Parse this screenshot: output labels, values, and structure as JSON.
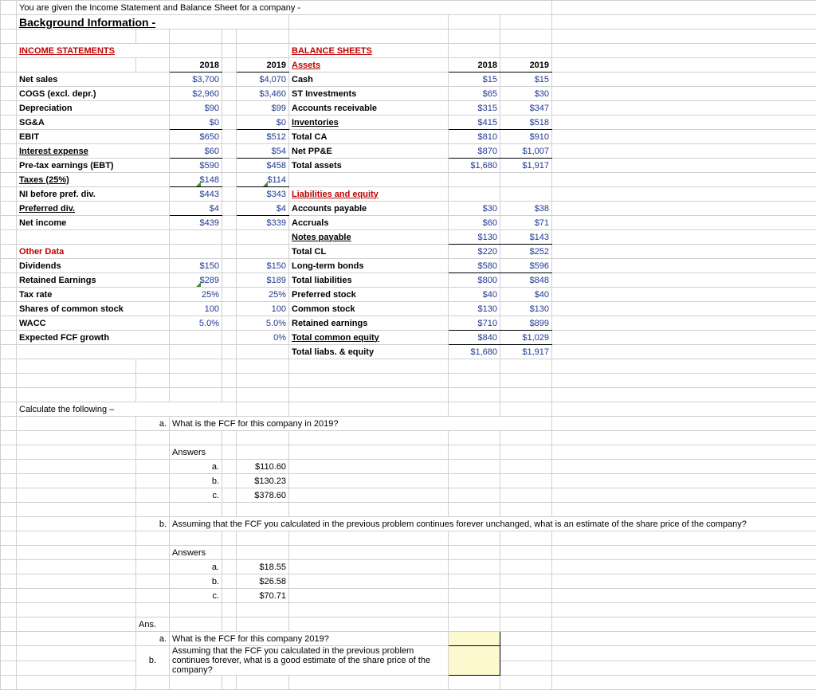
{
  "top_note": "You are given the Income Statement and Balance Sheet for a company -",
  "bg_title": "Background Information -",
  "is": {
    "title": "INCOME STATEMENTS",
    "y1": "2018",
    "y2": "2019",
    "rows": [
      {
        "l": "Net sales",
        "a": "$3,700",
        "b": "$4,070"
      },
      {
        "l": "COGS (excl. depr.)",
        "a": "$2,960",
        "b": "$3,460"
      },
      {
        "l": "Depreciation",
        "a": "$90",
        "b": "$99"
      },
      {
        "l": "SG&A",
        "a": "$0",
        "b": "$0",
        "ul": true
      },
      {
        "l": "EBIT",
        "a": "$650",
        "b": "$512"
      },
      {
        "l": "  Interest expense",
        "a": "$60",
        "b": "$54",
        "ul": true,
        "iul": true
      },
      {
        "l": "Pre-tax earnings (EBT)",
        "a": "$590",
        "b": "$458"
      },
      {
        "l": "  Taxes (25%)",
        "a": "$148",
        "b": "$114",
        "ul": true,
        "iul": true,
        "markA": true,
        "markB": true
      },
      {
        "l": "NI before pref. div.",
        "a": "$443",
        "b": "$343"
      },
      {
        "l": "  Preferred div.",
        "a": "$4",
        "b": "$4",
        "ul": true,
        "iul": true
      },
      {
        "l": "Net income",
        "a": "$439",
        "b": "$339"
      }
    ],
    "other_title": "Other Data",
    "other": [
      {
        "l": "Dividends",
        "a": "$150",
        "b": "$150"
      },
      {
        "l": "Retained Earnings",
        "a": "$289",
        "b": "$189",
        "markA": true
      },
      {
        "l": "Tax rate",
        "a": "25%",
        "b": "25%"
      },
      {
        "l": "Shares of common stock",
        "a": "100",
        "b": "100"
      },
      {
        "l": "WACC",
        "a": "5.0%",
        "b": "5.0%"
      },
      {
        "l": "Expected FCF growth",
        "a": "",
        "b": "0%"
      }
    ]
  },
  "bs": {
    "title": "BALANCE SHEETS",
    "assets_hdr": "Assets",
    "liab_hdr": "Liabilities and equity",
    "y1": "2018",
    "y2": "2019",
    "assets": [
      {
        "l": "  Cash",
        "a": "$15",
        "b": "$15"
      },
      {
        "l": "  ST Investments",
        "a": "$65",
        "b": "$30"
      },
      {
        "l": "  Accounts receivable",
        "a": "$315",
        "b": "$347"
      },
      {
        "l": "  Inventories",
        "a": "$415",
        "b": "$518",
        "ul": true,
        "iul": true
      },
      {
        "l": "Total CA",
        "a": "$810",
        "b": "$910"
      },
      {
        "l": "Net PP&E",
        "a": "$870",
        "b": "$1,007",
        "ul": true
      },
      {
        "l": "Total assets",
        "a": "$1,680",
        "b": "$1,917"
      }
    ],
    "liab": [
      {
        "l": "  Accounts payable",
        "a": "$30",
        "b": "$38"
      },
      {
        "l": "  Accruals",
        "a": "$60",
        "b": "$71"
      },
      {
        "l": "  Notes payable",
        "a": "$130",
        "b": "$143",
        "ul": true,
        "iul": true
      },
      {
        "l": "Total CL",
        "a": "$220",
        "b": "$252"
      },
      {
        "l": "Long-term bonds",
        "a": "$580",
        "b": "$596",
        "ul": true
      },
      {
        "l": "Total liabilities",
        "a": "$800",
        "b": "$848"
      },
      {
        "l": "Preferred stock",
        "a": "$40",
        "b": "$40"
      },
      {
        "l": "  Common stock",
        "a": "$130",
        "b": "$130"
      },
      {
        "l": "  Retained earnings",
        "a": "$710",
        "b": "$899",
        "ul": true
      },
      {
        "l": "Total common equity",
        "a": "$840",
        "b": "$1,029",
        "ul": true,
        "iul": true
      },
      {
        "l": "Total liabs. & equity",
        "a": "$1,680",
        "b": "$1,917"
      }
    ]
  },
  "q": {
    "calc": "Calculate the following –",
    "a_letter": "a.",
    "b_letter": "b.",
    "c_letter": "c.",
    "q_a": "What is the FCF for this company in 2019?",
    "q_b": "Assuming that the FCF you calculated in the previous problem continues forever unchanged, what is an estimate of the share price of the company?",
    "answers_label": "Answers",
    "ans_a": [
      "$110.60",
      "$130.23",
      "$378.60"
    ],
    "ans_b": [
      "$18.55",
      "$26.58",
      "$70.71"
    ],
    "ans_label": "Ans.",
    "final_a": "What is the FCF for this company 2019?",
    "final_b": "Assuming that the FCF you calculated in the previous problem continues forever, what is a good estimate of the share price of the company?"
  }
}
